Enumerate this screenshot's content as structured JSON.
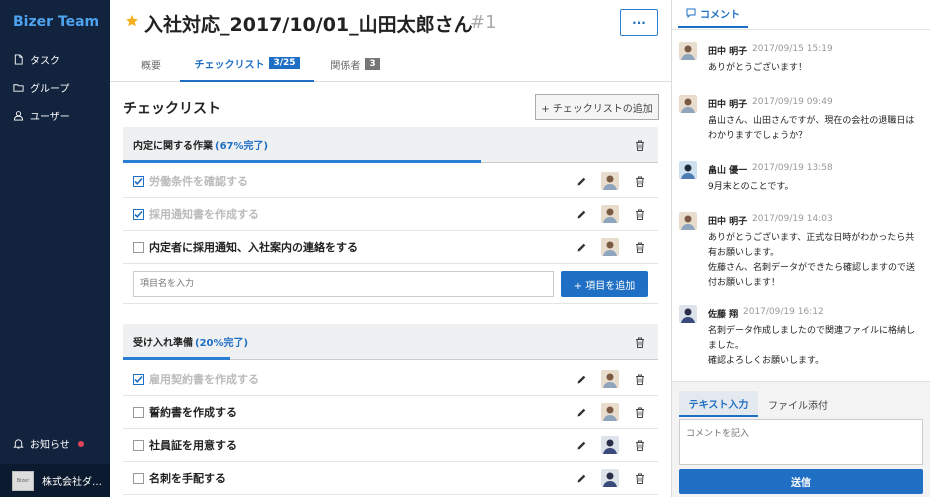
{
  "sidebar": {
    "brand": "Bizer Team",
    "items": [
      {
        "label": "タスク",
        "icon": "file-icon"
      },
      {
        "label": "グループ",
        "icon": "folder-icon"
      },
      {
        "label": "ユーザー",
        "icon": "user-icon"
      }
    ],
    "notice_label": "お知らせ",
    "company_name": "株式会社ダ…",
    "company_avatar_text": "Bizer"
  },
  "header": {
    "title": "入社対応_2017/10/01_山田太郎さん",
    "ticket": "#1",
    "more_label": "···"
  },
  "tabs": [
    {
      "label": "概要"
    },
    {
      "label": "チェックリスト",
      "badge": "3/25"
    },
    {
      "label": "関係者",
      "badge": "3"
    }
  ],
  "checklist": {
    "heading": "チェックリスト",
    "add_button_label": "+ チェックリストの追加",
    "groups": [
      {
        "title": "内定に関する作業",
        "progress_label": "(67%完了)",
        "progress": 0.67,
        "items": [
          {
            "label": "労働条件を確認する",
            "done": true
          },
          {
            "label": "採用通知書を作成する",
            "done": true
          },
          {
            "label": "内定者に採用通知、入社案内の連絡をする",
            "done": false
          }
        ],
        "input_placeholder": "項目名を入力",
        "add_item_label": "+ 項目を追加"
      },
      {
        "title": "受け入れ準備",
        "progress_label": "(20%完了)",
        "progress": 0.2,
        "items": [
          {
            "label": "雇用契約書を作成する",
            "done": true
          },
          {
            "label": "誓約書を作成する",
            "done": false
          },
          {
            "label": "社員証を用意する",
            "done": false
          },
          {
            "label": "名刺を手配する",
            "done": false
          }
        ]
      }
    ]
  },
  "comments_panel": {
    "tab_label": "コメント",
    "comments": [
      {
        "name": "田中 明子",
        "time": "2017/09/15 15:19",
        "text": [
          "ありがとうございます！"
        ]
      },
      {
        "name": "田中 明子",
        "time": "2017/09/19 09:49",
        "text": [
          "畠山さん、山田さんですが、現在の会社の退職日は",
          "わかりますでしょうか？"
        ]
      },
      {
        "name": "畠山 優一",
        "time": "2017/09/19 13:58",
        "text": [
          "9月末とのことです。"
        ]
      },
      {
        "name": "田中 明子",
        "time": "2017/09/19 14:03",
        "text": [
          "ありがとうございます、正式な日時がわかったら共",
          "有お願いします。",
          "佐藤さん、名刺データができたら確認しますので送",
          "付お願いします！"
        ]
      },
      {
        "name": "佐藤 翔",
        "time": "2017/09/19 16:12",
        "text": [
          "名刺データ作成しましたので関連ファイルに格納し",
          "ました。",
          "確認よろしくお願いします。"
        ]
      }
    ],
    "compose": {
      "tab_text": "テキスト入力",
      "tab_file": "ファイル添付",
      "placeholder": "コメントを記入",
      "send_label": "送信"
    }
  },
  "colors": {
    "accent": "#1f6fc4",
    "sidebar_bg": "#12233d",
    "brand": "#4ea3f0",
    "notice_dot": "#e2455a"
  }
}
